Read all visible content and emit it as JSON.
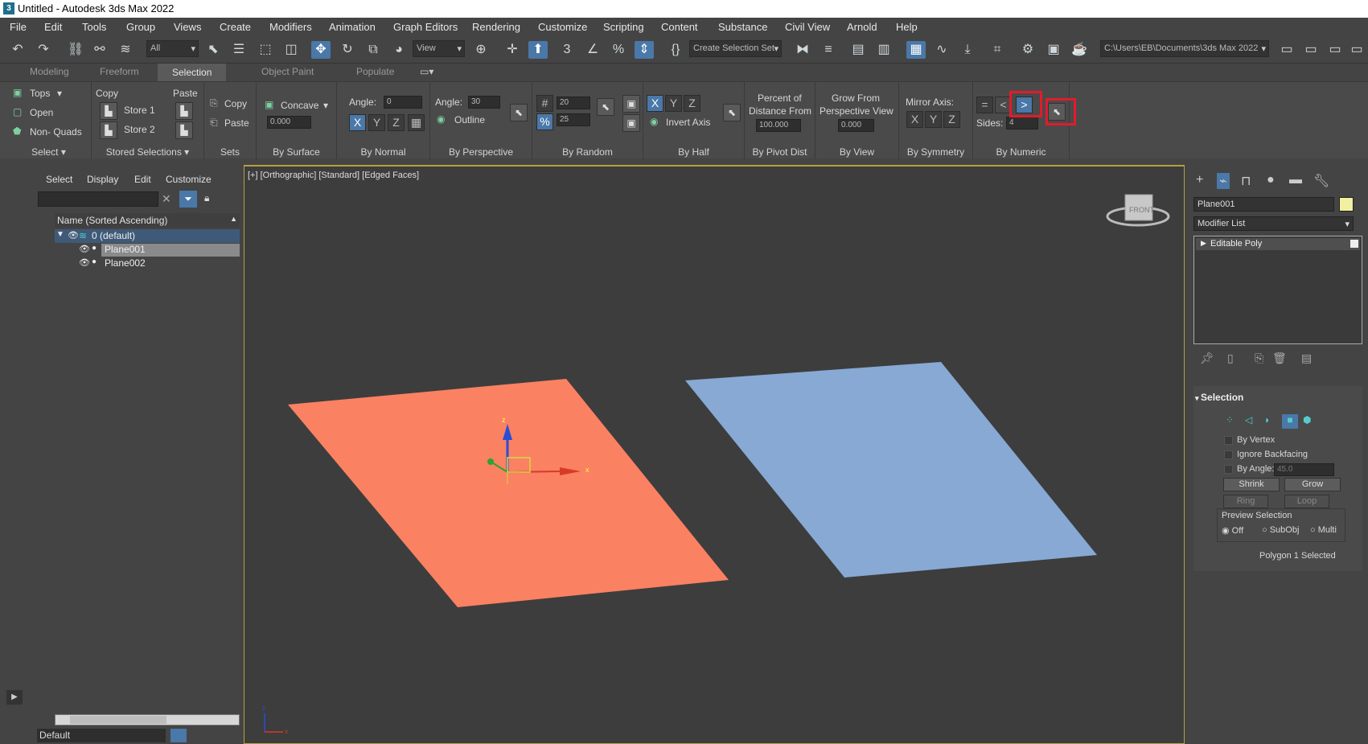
{
  "window": {
    "title": "Untitled - Autodesk 3ds Max 2022",
    "app_icon": "3"
  },
  "menu": [
    "File",
    "Edit",
    "Tools",
    "Group",
    "Views",
    "Create",
    "Modifiers",
    "Animation",
    "Graph Editors",
    "Rendering",
    "Customize",
    "Scripting",
    "Content",
    "Substance",
    "Civil View",
    "Arnold",
    "Help"
  ],
  "toolbar": {
    "filter": "All",
    "ref_coord": "View",
    "named_selection": "Create Selection Set",
    "project_path": "C:\\Users\\EB\\Documents\\3ds Max 2022"
  },
  "ribbon_tabs": [
    "Modeling",
    "Freeform",
    "Selection",
    "Object Paint",
    "Populate"
  ],
  "ribbon": {
    "select": {
      "tops": "Tops",
      "open": "Open",
      "non_quads": "Non- Quads",
      "label": "Select"
    },
    "stored": {
      "copy": "Copy",
      "paste": "Paste",
      "store1": "Store 1",
      "store2": "Store 2",
      "label": "Stored Selections"
    },
    "sets": {
      "copy": "Copy",
      "paste": "Paste",
      "label": "Sets"
    },
    "by_surface": {
      "mode": "Concave",
      "value": "0.000",
      "label": "By Surface"
    },
    "by_normal": {
      "angle_label": "Angle:",
      "angle": "0",
      "x": "X",
      "y": "Y",
      "z": "Z",
      "label": "By Normal"
    },
    "by_perspective": {
      "angle_label": "Angle:",
      "angle": "30",
      "outline": "Outline",
      "label": "By Perspective"
    },
    "by_random": {
      "count": "20",
      "percent": "25",
      "label": "By Random"
    },
    "by_half": {
      "x": "X",
      "y": "Y",
      "z": "Z",
      "invert": "Invert Axis",
      "label": "By Half"
    },
    "by_pivot": {
      "line1": "Percent of",
      "line2": "Distance From",
      "value": "100.000",
      "label": "By Pivot Dist"
    },
    "by_view": {
      "line1": "Grow From",
      "line2": "Perspective View",
      "value": "0.000",
      "label": "By View"
    },
    "by_symmetry": {
      "title": "Mirror Axis:",
      "x": "X",
      "y": "Y",
      "z": "Z",
      "label": "By Symmetry"
    },
    "by_numeric": {
      "sides_label": "Sides:",
      "sides": "4",
      "label": "By Numeric"
    }
  },
  "scene_explorer": {
    "menu": [
      "Select",
      "Display",
      "Edit",
      "Customize"
    ],
    "header": "Name (Sorted Ascending)",
    "rows": [
      {
        "name": "0 (default)"
      },
      {
        "name": "Plane001"
      },
      {
        "name": "Plane002"
      }
    ],
    "layer": "Default"
  },
  "viewport": {
    "label": "[+] [Orthographic] [Standard] [Edged Faces]",
    "viewcube": "FRONT"
  },
  "command_panel": {
    "object_name": "Plane001",
    "object_color": "#f0f0a0",
    "modifier_list": "Modifier List",
    "stack_item": "Editable Poly",
    "rollout_title": "Selection",
    "by_vertex": "By Vertex",
    "ignore_backfacing": "Ignore Backfacing",
    "by_angle": "By Angle:",
    "by_angle_value": "45.0",
    "shrink": "Shrink",
    "grow": "Grow",
    "ring": "Ring",
    "loop": "Loop",
    "preview_title": "Preview Selection",
    "preview_off": "Off",
    "preview_subobj": "SubObj",
    "preview_multi": "Multi",
    "status": "Polygon 1 Selected"
  },
  "colors": {
    "plane1": "#fa8162",
    "plane2": "#87a9d4",
    "accent": "#4a78a8",
    "highlight": "#e21b2b"
  }
}
